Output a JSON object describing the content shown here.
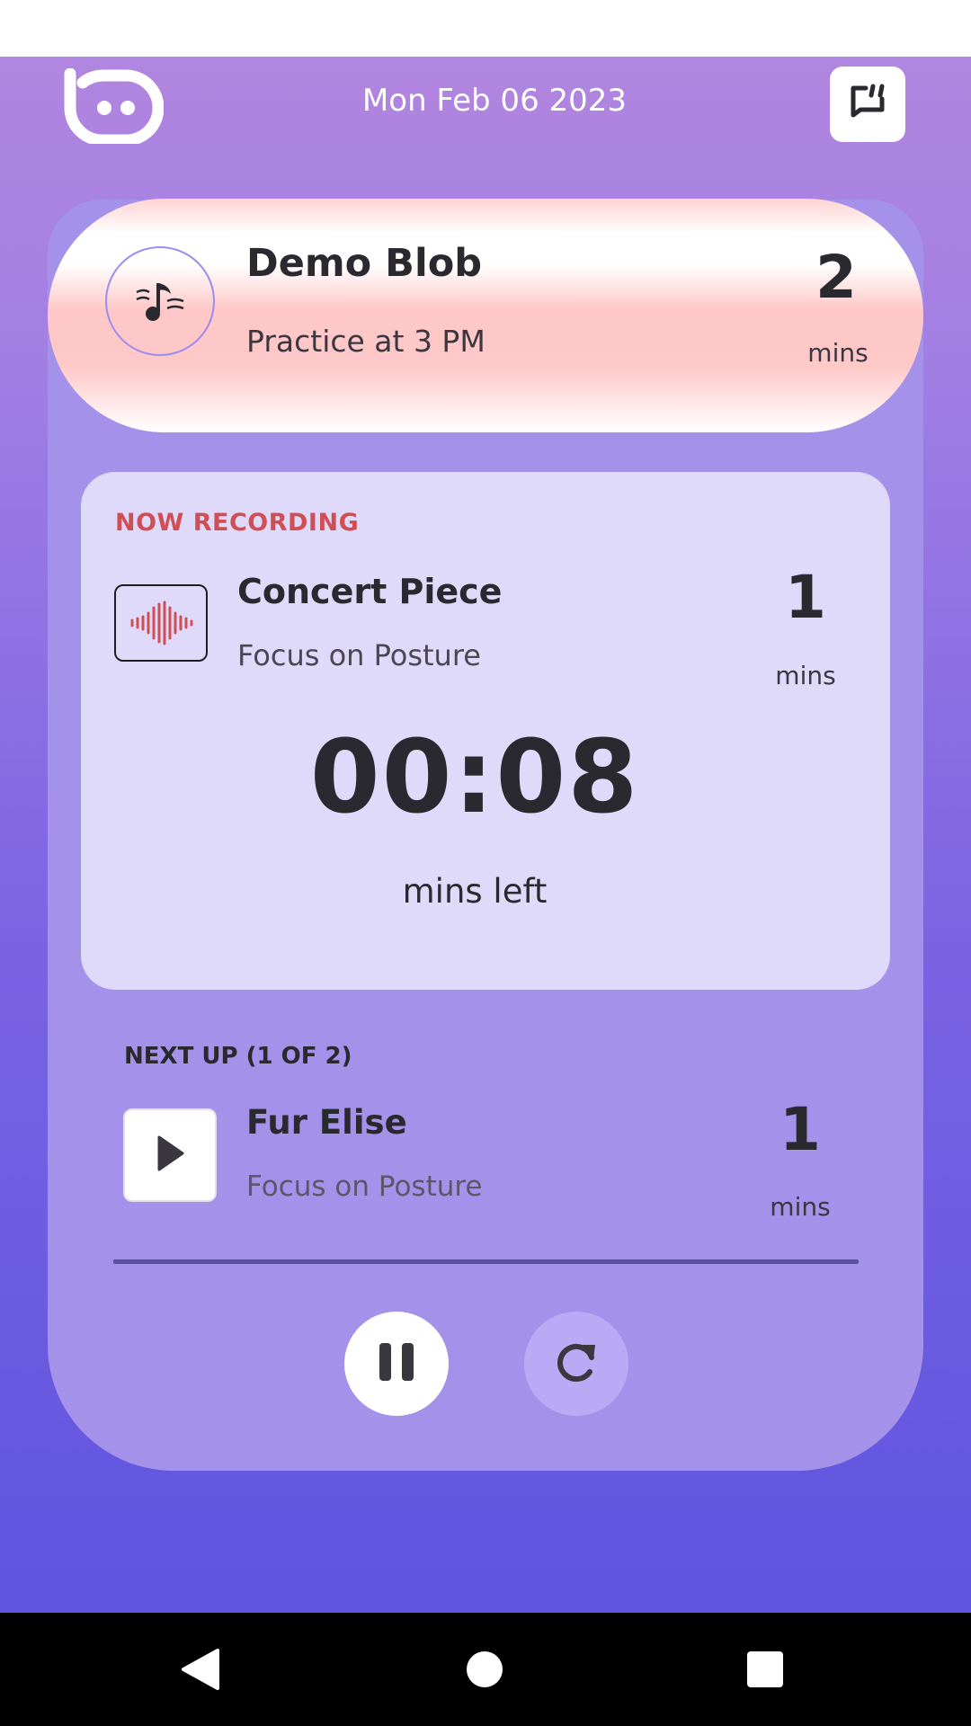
{
  "header": {
    "date": "Mon Feb 06 2023",
    "logo_icon": "blob-face-logo",
    "feedback_icon": "feedback-icon"
  },
  "session": {
    "title": "Demo Blob",
    "subtitle": "Practice at 3 PM",
    "minutes": "2",
    "minutes_label": "mins",
    "icon": "music-note-icon"
  },
  "recording": {
    "status_label": "NOW RECORDING",
    "title": "Concert Piece",
    "subtitle": "Focus on Posture",
    "minutes": "1",
    "minutes_label": "mins",
    "timer": "00:08",
    "timer_label": "mins left",
    "icon": "waveform-icon",
    "accent_color": "#cf4f55"
  },
  "next_up": {
    "label": "NEXT UP (1 OF 2)",
    "title": "Fur Elise",
    "subtitle": "Focus on Posture",
    "minutes": "1",
    "minutes_label": "mins",
    "icon": "play-icon"
  },
  "controls": {
    "pause_icon": "pause-icon",
    "restart_icon": "restart-icon"
  },
  "colors": {
    "panel": "#a492ea",
    "card": "#e0dafa",
    "background_top": "#b487df",
    "background_bottom": "#5a52de"
  }
}
